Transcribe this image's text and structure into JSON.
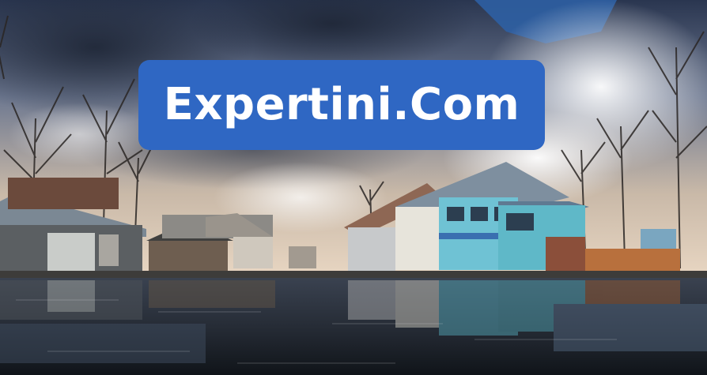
{
  "brand": {
    "text": "Expertini.Com",
    "banner_color": "#2f67c3",
    "text_color": "#ffffff"
  },
  "photo": {
    "subject": "lakeside-houses-reflection"
  }
}
